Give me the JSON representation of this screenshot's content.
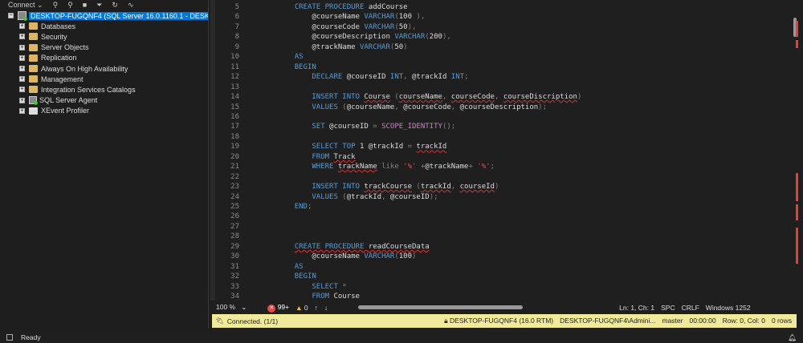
{
  "toolbar": {
    "connect": "Connect",
    "chevron": "⌄"
  },
  "tree": {
    "server": "DESKTOP-FUGQNF4 (SQL Server 16.0.1160.1 - DESKTOP-FUGQNF4\\Administrator)",
    "items": [
      "Databases",
      "Security",
      "Server Objects",
      "Replication",
      "Always On High Availability",
      "Management",
      "Integration Services Catalogs",
      "SQL Server Agent",
      "XEvent Profiler"
    ]
  },
  "code": [
    {
      "n": "5",
      "t": [
        [
          "",
          "    "
        ],
        [
          "kw",
          "CREATE PROCEDURE "
        ],
        [
          "id",
          "addCourse"
        ]
      ]
    },
    {
      "n": "6",
      "t": [
        [
          "",
          "        "
        ],
        [
          "id",
          "@courseName "
        ],
        [
          "kw",
          "VARCHAR"
        ],
        [
          "gr",
          "("
        ],
        [
          "id",
          "100"
        ],
        [
          "gr",
          " ),"
        ]
      ]
    },
    {
      "n": "7",
      "t": [
        [
          "",
          "        "
        ],
        [
          "id",
          "@courseCode "
        ],
        [
          "kw",
          "VARCHAR"
        ],
        [
          "gr",
          "("
        ],
        [
          "id",
          "50"
        ],
        [
          "gr",
          "),"
        ]
      ]
    },
    {
      "n": "8",
      "t": [
        [
          "",
          "        "
        ],
        [
          "id",
          "@courseDescription "
        ],
        [
          "kw",
          "VARCHAR"
        ],
        [
          "gr",
          "("
        ],
        [
          "id",
          "200"
        ],
        [
          "gr",
          "),"
        ]
      ]
    },
    {
      "n": "9",
      "t": [
        [
          "",
          "        "
        ],
        [
          "id",
          "@trackName "
        ],
        [
          "kw",
          "VARCHAR"
        ],
        [
          "gr",
          "("
        ],
        [
          "id",
          "50"
        ],
        [
          "gr",
          ")"
        ]
      ]
    },
    {
      "n": "10",
      "t": [
        [
          "",
          "    "
        ],
        [
          "kw",
          "AS"
        ]
      ]
    },
    {
      "n": "11",
      "t": [
        [
          "",
          "    "
        ],
        [
          "kw",
          "BEGIN"
        ]
      ]
    },
    {
      "n": "12",
      "t": [
        [
          "",
          "        "
        ],
        [
          "kw",
          "DECLARE "
        ],
        [
          "id",
          "@courseID "
        ],
        [
          "kw",
          "INT"
        ],
        [
          "gr",
          ", "
        ],
        [
          "id",
          "@trackId "
        ],
        [
          "kw",
          "INT"
        ],
        [
          "gr",
          ";"
        ]
      ]
    },
    {
      "n": "13",
      "t": []
    },
    {
      "n": "14",
      "t": [
        [
          "",
          "        "
        ],
        [
          "kw",
          "INSERT INTO "
        ],
        [
          "id err",
          "Course"
        ],
        [
          "gr",
          " ("
        ],
        [
          "id err",
          "courseName"
        ],
        [
          "gr",
          ", "
        ],
        [
          "id err",
          "courseCode"
        ],
        [
          "gr",
          ", "
        ],
        [
          "id err",
          "courseDiscription"
        ],
        [
          "gr",
          ")"
        ]
      ]
    },
    {
      "n": "15",
      "t": [
        [
          "",
          "        "
        ],
        [
          "kw",
          "VALUES "
        ],
        [
          "gr",
          "("
        ],
        [
          "id",
          "@courseName"
        ],
        [
          "gr",
          ", "
        ],
        [
          "id",
          "@courseCode"
        ],
        [
          "gr",
          ", "
        ],
        [
          "id",
          "@courseDescription"
        ],
        [
          "gr",
          ");"
        ]
      ]
    },
    {
      "n": "16",
      "t": []
    },
    {
      "n": "17",
      "t": [
        [
          "",
          "        "
        ],
        [
          "kw",
          "SET "
        ],
        [
          "id",
          "@courseID "
        ],
        [
          "gr",
          "= "
        ],
        [
          "fn",
          "SCOPE_IDENTITY"
        ],
        [
          "gr",
          "();"
        ]
      ]
    },
    {
      "n": "18",
      "t": []
    },
    {
      "n": "19",
      "t": [
        [
          "",
          "        "
        ],
        [
          "kw",
          "SELECT TOP "
        ],
        [
          "id",
          "1 @trackId "
        ],
        [
          "gr",
          "= "
        ],
        [
          "id err",
          "trackId"
        ]
      ]
    },
    {
      "n": "20",
      "t": [
        [
          "",
          "        "
        ],
        [
          "kw",
          "FROM "
        ],
        [
          "id err",
          "Track"
        ]
      ]
    },
    {
      "n": "21",
      "t": [
        [
          "",
          "        "
        ],
        [
          "kw",
          "WHERE "
        ],
        [
          "id err",
          "trackName"
        ],
        [
          "gr",
          " like "
        ],
        [
          "st",
          "'%'"
        ],
        [
          "gr",
          " +"
        ],
        [
          "id",
          "@trackName"
        ],
        [
          "gr",
          "+ "
        ],
        [
          "st",
          "'%'"
        ],
        [
          "gr",
          ";"
        ]
      ]
    },
    {
      "n": "22",
      "t": []
    },
    {
      "n": "23",
      "t": [
        [
          "",
          "        "
        ],
        [
          "kw",
          "INSERT INTO "
        ],
        [
          "id err",
          "trackCourse"
        ],
        [
          "gr",
          " ("
        ],
        [
          "id err",
          "trackId"
        ],
        [
          "gr",
          ", "
        ],
        [
          "id err",
          "courseId"
        ],
        [
          "gr",
          ")"
        ]
      ]
    },
    {
      "n": "24",
      "t": [
        [
          "",
          "        "
        ],
        [
          "kw",
          "VALUES "
        ],
        [
          "gr",
          "("
        ],
        [
          "id",
          "@trackId"
        ],
        [
          "gr",
          ", "
        ],
        [
          "id",
          "@courseID"
        ],
        [
          "gr",
          ");"
        ]
      ]
    },
    {
      "n": "25",
      "t": [
        [
          "",
          "    "
        ],
        [
          "kw",
          "END"
        ],
        [
          "gr",
          ";"
        ]
      ]
    },
    {
      "n": "26",
      "t": []
    },
    {
      "n": "27",
      "t": []
    },
    {
      "n": "28",
      "t": []
    },
    {
      "n": "29",
      "t": [
        [
          "",
          "    "
        ],
        [
          "kw err",
          "CREATE PROCEDURE "
        ],
        [
          "id err",
          "readCourseData"
        ]
      ]
    },
    {
      "n": "30",
      "t": [
        [
          "",
          "        "
        ],
        [
          "id",
          "@courseName "
        ],
        [
          "kw",
          "VARCHAR"
        ],
        [
          "gr",
          "("
        ],
        [
          "id",
          "100"
        ],
        [
          "gr",
          ")"
        ]
      ]
    },
    {
      "n": "31",
      "t": [
        [
          "",
          "    "
        ],
        [
          "kw",
          "AS"
        ]
      ]
    },
    {
      "n": "32",
      "t": [
        [
          "",
          "    "
        ],
        [
          "kw",
          "BEGIN"
        ]
      ]
    },
    {
      "n": "33",
      "t": [
        [
          "",
          "        "
        ],
        [
          "kw",
          "SELECT "
        ],
        [
          "gr",
          "*"
        ]
      ]
    },
    {
      "n": "34",
      "t": [
        [
          "",
          "        "
        ],
        [
          "kw",
          "FROM "
        ],
        [
          "id",
          "Course"
        ]
      ]
    }
  ],
  "status": {
    "zoom": "100 %",
    "errors": "99+",
    "warnings": "0",
    "position": "Ln: 1, Ch: 1",
    "spc": "SPC",
    "eol": "CRLF",
    "encoding": "Windows 1252"
  },
  "connection": {
    "state": "Connected. (1/1)",
    "server": "DESKTOP-FUGQNF4 (16.0 RTM)",
    "user": "DESKTOP-FUGQNF4\\Admini...",
    "database": "master",
    "time": "00:00:00",
    "rowcol": "Row: 0, Col: 0",
    "rows": "0 rows",
    "bg": "#f1ea9a"
  },
  "footer": {
    "ready": "Ready"
  }
}
